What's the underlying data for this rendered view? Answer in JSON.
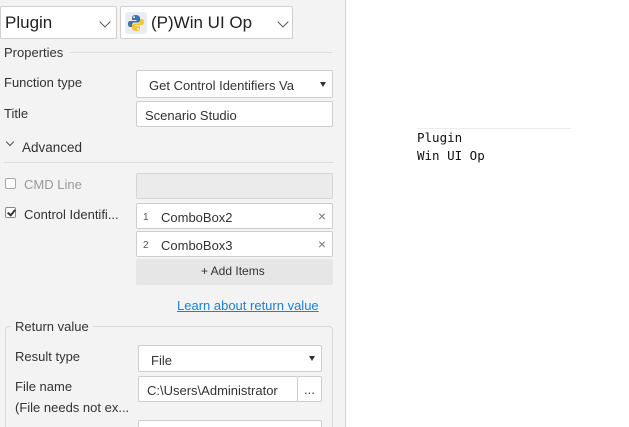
{
  "header": {
    "category_value": "Plugin",
    "plugin_value": "(P)Win UI Op"
  },
  "properties": {
    "group_label": "Properties",
    "function_type_label": "Function type",
    "function_type_value": "Get Control Identifiers Va",
    "title_label": "Title",
    "title_value": "Scenario Studio"
  },
  "advanced": {
    "label": "Advanced",
    "cmd_line_label": "CMD Line",
    "cmd_line_checked": false,
    "cmd_line_value": "",
    "control_identifiers_label": "Control Identifi...",
    "control_identifiers_checked": true,
    "items": [
      {
        "index": "1",
        "value": "ComboBox2",
        "remove": "×"
      },
      {
        "index": "2",
        "value": "ComboBox3",
        "remove": "×"
      }
    ],
    "add_items_label": "+ Add Items",
    "learn_link": "Learn about return value"
  },
  "return_value": {
    "group_label": "Return value",
    "result_type_label": "Result type",
    "result_type_value": "File",
    "file_name_label": "File name",
    "file_name_note": "(File needs not ex...",
    "file_name_value": "C:\\Users\\Administrator",
    "browse_label": "..."
  },
  "preview": {
    "line1": "Plugin",
    "line2": "Win UI Op"
  }
}
